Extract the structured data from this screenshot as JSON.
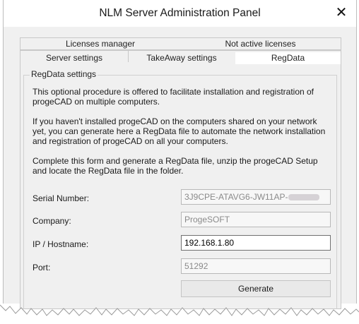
{
  "window": {
    "title": "NLM Server Administration Panel",
    "close_glyph": "✕"
  },
  "tabs": {
    "top_row": [
      "Licenses manager",
      "Not active licenses"
    ],
    "bottom_row": [
      "Server settings",
      "TakeAway settings",
      "RegData"
    ],
    "selected": "RegData"
  },
  "regdata": {
    "group_title": "RegData settings",
    "para1": "This optional procedure is offered to facilitate installation and registration of progeCAD on multiple computers.",
    "para2": "If you haven't installed progeCAD on the computers shared on your network yet, you can generate here a RegData file to automate the network installation and registration of progeCAD on all your computers.",
    "para3": "Complete this form and generate a RegData file, unzip the progeCAD Setup and locate the RegData file in the folder.",
    "fields": {
      "serial_label": "Serial Number:",
      "serial_value": "3J9CPE-ATAVG6-JW11AP-",
      "company_label": "Company:",
      "company_value": "ProgeSOFT",
      "ip_label": "IP / Hostname:",
      "ip_value": "192.168.1.80",
      "port_label": "Port:",
      "port_value": "51292"
    },
    "generate_label": "Generate"
  }
}
